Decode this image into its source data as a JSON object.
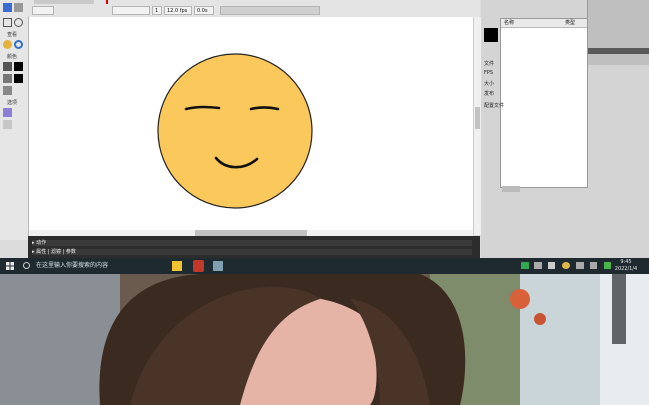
{
  "timeline": {
    "fps": "12.0 fps",
    "time": "0.0s",
    "frame": "1"
  },
  "tools": {
    "label_view": "查看",
    "label_color": "颜色",
    "label_options": "选项"
  },
  "right_panel": {
    "col1": "名称",
    "col2": "类型"
  },
  "properties": {
    "label1": "文件",
    "label2": "FPS",
    "label3": "大小",
    "label4": "发布",
    "label5": "配置文件"
  },
  "bottom": {
    "bar1": "▸ 动作",
    "bar2": "▸ 属性 | 滤镜 | 参数"
  },
  "taskbar": {
    "search_placeholder": "在这里输入你要搜索的内容",
    "clock_time": "9:45",
    "clock_date": "2022/1/4"
  },
  "colors": {
    "face": "#fbc85b",
    "stage": "#ffffff",
    "taskbar": "#1f2a30"
  }
}
